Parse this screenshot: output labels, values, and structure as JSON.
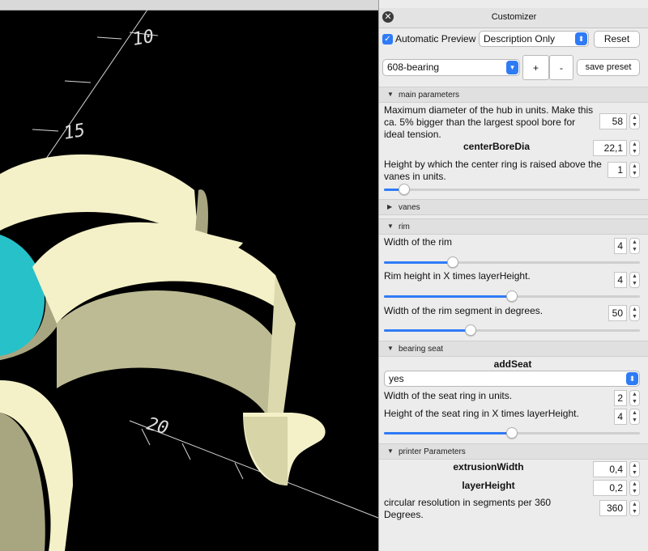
{
  "window": {
    "title": "Customizer"
  },
  "toolbar": {
    "auto_preview_label": "Automatic Preview",
    "auto_preview_checked": true,
    "mode_select": "Description Only",
    "reset_label": "Reset",
    "preset_select": "608-bearing",
    "plus_label": "+",
    "minus_label": "-",
    "save_preset_label": "save preset"
  },
  "sections": {
    "main": {
      "title": "main parameters",
      "p1_desc": "Maximum diameter of the hub in units. Make this ca. 5% bigger than the largest spool bore for ideal tension.",
      "p1_value": "58",
      "p2_name": "centerBoreDia",
      "p2_value": "22,1",
      "p3_desc": "Height by which the center ring is raised above the vanes in units.",
      "p3_value": "1",
      "p3_slider": 0.08
    },
    "vanes": {
      "title": "vanes"
    },
    "rim": {
      "title": "rim",
      "p1_desc": "Width of the rim",
      "p1_value": "4",
      "p1_slider": 0.27,
      "p2_desc": "Rim height in X times layerHeight.",
      "p2_value": "4",
      "p2_slider": 0.5,
      "p3_desc": "Width of the rim segment in degrees.",
      "p3_value": "50",
      "p3_slider": 0.34
    },
    "seat": {
      "title": "bearing seat",
      "p1_name": "addSeat",
      "p1_select": "yes",
      "p2_desc": "Width of the seat ring in units.",
      "p2_value": "2",
      "p3_desc": "Height of the seat ring in X times layerHeight.",
      "p3_value": "4",
      "p3_slider": 0.5
    },
    "printer": {
      "title": "printer Parameters",
      "p1_name": "extrusionWidth",
      "p1_value": "0,4",
      "p2_name": "layerHeight",
      "p2_value": "0,2",
      "p3_desc": "circular resolution in segments per 360 Degrees.",
      "p3_value": "360"
    }
  },
  "viewport": {
    "axis_labels": [
      "10",
      "15",
      "20"
    ],
    "colors": {
      "model": "#f4f1c8",
      "model_shade": "#a8a681",
      "inner": "#27c1c9",
      "background": "#000000"
    }
  }
}
